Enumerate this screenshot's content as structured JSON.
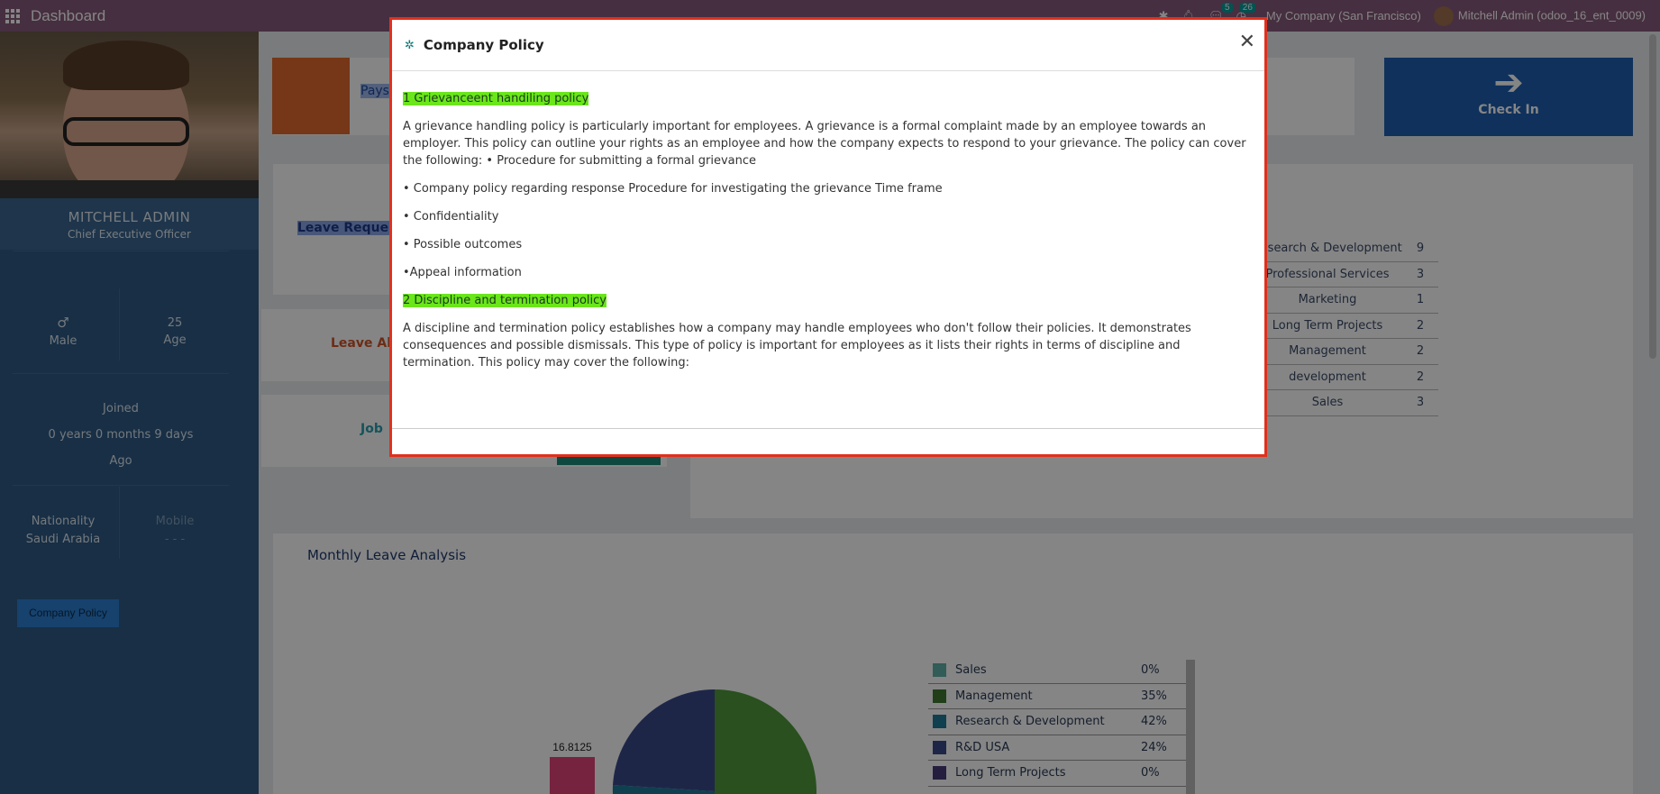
{
  "topbar": {
    "brand": "Dashboard",
    "messages_badge": "5",
    "activities_badge": "26",
    "company": "My Company (San Francisco)",
    "user": "Mitchell Admin (odoo_16_ent_0009)"
  },
  "profile": {
    "name": "MITCHELL ADMIN",
    "job": "Chief Executive Officer",
    "gender_symbol": "♂",
    "gender": "Male",
    "age_value": "25",
    "age_label": "Age",
    "joined_label": "Joined",
    "joined_duration": "0 years 0 months 9 days",
    "joined_suffix": "Ago",
    "nationality_label": "Nationality",
    "nationality": "Saudi Arabia",
    "mobile_label": "Mobile",
    "mobile": "- - -",
    "policy_button": "Company Policy"
  },
  "cards": {
    "payslip_label": "Pays",
    "leave_requests": "Leave Requests",
    "leave_alloc": "Leave All",
    "job_label": "Job",
    "checkin_label": "Check In"
  },
  "dept_table": [
    {
      "name": "Research & Development",
      "count": "9"
    },
    {
      "name": "Professional Services",
      "count": "3"
    },
    {
      "name": "Marketing",
      "count": "1"
    },
    {
      "name": "Long Term Projects",
      "count": "2"
    },
    {
      "name": "Management",
      "count": "2"
    },
    {
      "name": "development",
      "count": "2"
    },
    {
      "name": "Sales",
      "count": "3"
    }
  ],
  "leave_analysis": {
    "title": "Monthly Leave Analysis",
    "bar_label": "16.8125",
    "legend": [
      {
        "name": "Sales",
        "pct": "0%",
        "color": "#5fb0a9"
      },
      {
        "name": "Management",
        "pct": "35%",
        "color": "#3f7a2e"
      },
      {
        "name": "Research & Development",
        "pct": "42%",
        "color": "#1f7a9a"
      },
      {
        "name": "R&D USA",
        "pct": "24%",
        "color": "#3a4a8a"
      },
      {
        "name": "Long Term Projects",
        "pct": "0%",
        "color": "#4a3a7a"
      }
    ]
  },
  "modal": {
    "title": "Company Policy",
    "h1": "1 Grievanceent handiling policy",
    "p1": "A grievance handling policy is particularly important for employees. A grievance is a formal complaint made by an employee towards an employer. This policy can outline your rights as an employee and how the company expects to respond to your grievance. The policy can cover the following: • Procedure for submitting a formal grievance",
    "b1": "• Company policy regarding response Procedure for investigating the grievance  Time frame",
    "b2": "• Confidentiality",
    "b3": "• Possible outcomes",
    "b4": "•Appeal information",
    "h2": "2 Discipline and termination policy",
    "p2": "A discipline and termination policy establishes how a company may handle employees who don't follow their policies. It demonstrates consequences and possible dismissals. This type of policy is important for employees as it lists their rights in terms of discipline and termination. This policy may cover the following:"
  }
}
